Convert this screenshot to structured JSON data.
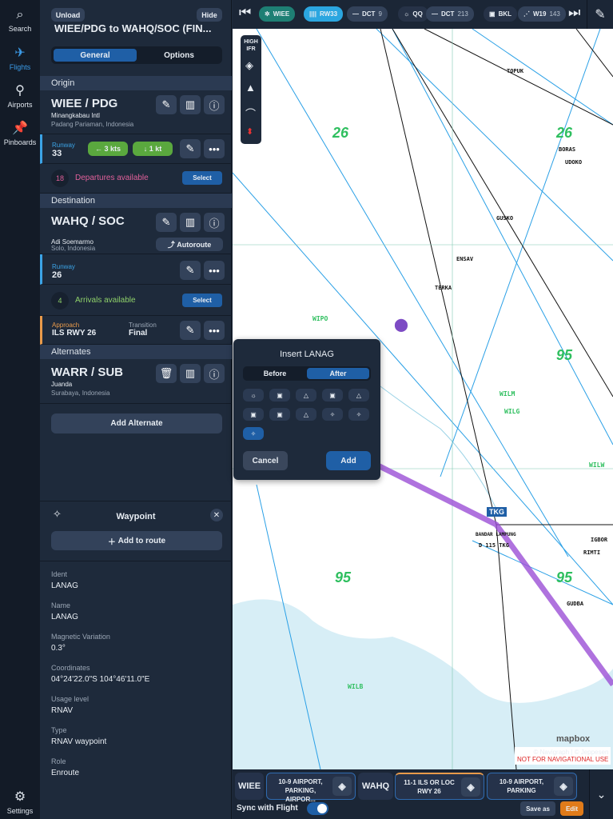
{
  "rail": {
    "items": [
      {
        "label": "Search",
        "icon": "search-icon"
      },
      {
        "label": "Flights",
        "icon": "plane-icon"
      },
      {
        "label": "Airports",
        "icon": "airport-icon"
      },
      {
        "label": "Pinboards",
        "icon": "pin-icon"
      }
    ],
    "settings": "Settings"
  },
  "flight": {
    "unload": "Unload",
    "hide": "Hide",
    "title": "WIEE/PDG to WAHQ/SOC (FIN...",
    "tabs": [
      "General",
      "Options"
    ],
    "origin": {
      "header": "Origin",
      "code": "WIEE / PDG",
      "name": "Minangkabau Intl",
      "city": "Padang Pariaman, Indonesia",
      "runway_label": "Runway",
      "runway": "33",
      "wind1": "← 3 kts",
      "wind2": "↓ 1 kt",
      "departures_count": "18",
      "departures_text": "Departures available",
      "select": "Select"
    },
    "destination": {
      "header": "Destination",
      "code": "WAHQ / SOC",
      "name": "Adi Soemarmo",
      "city": "Solo, Indonesia",
      "autoroute": "Autoroute",
      "runway_label": "Runway",
      "runway": "26",
      "arrivals_count": "4",
      "arrivals_text": "Arrivals available",
      "select": "Select",
      "approach_label": "Approach",
      "approach": "ILS RWY 26",
      "transition_label": "Transition",
      "transition": "Final"
    },
    "alternates": {
      "header": "Alternates",
      "code": "WARR / SUB",
      "name": "Juanda",
      "city": "Surabaya, Indonesia",
      "add": "Add Alternate"
    }
  },
  "waypoint": {
    "title": "Waypoint",
    "add": "Add to route",
    "fields": [
      {
        "label": "Ident",
        "value": "LANAG"
      },
      {
        "label": "Name",
        "value": "LANAG"
      },
      {
        "label": "Magnetic Variation",
        "value": "0.3°"
      },
      {
        "label": "Coordinates",
        "value": "04°24'22.0\"S  104°46'11.0\"E"
      },
      {
        "label": "Usage level",
        "value": "RNAV"
      },
      {
        "label": "Type",
        "value": "RNAV waypoint"
      },
      {
        "label": "Role",
        "value": "Enroute"
      }
    ]
  },
  "topbar": {
    "chips": [
      {
        "label": "WIEE",
        "extra": "",
        "icon": "airport-icon",
        "color": "#1e7f74"
      },
      {
        "label": "RW33",
        "extra": "",
        "icon": "runway-icon",
        "color": "#2ba6e0"
      },
      {
        "label": "DCT",
        "extra": "9",
        "icon": "direct-icon",
        "color": "#33425a"
      },
      {
        "label": "QQ",
        "extra": "",
        "icon": "vor-icon",
        "color": "#263247"
      },
      {
        "label": "DCT",
        "extra": "213",
        "icon": "direct-icon",
        "color": "#33425a"
      },
      {
        "label": "BKL",
        "extra": "",
        "icon": "ndb-icon",
        "color": "#263247"
      },
      {
        "label": "W19",
        "extra": "143",
        "icon": "airway-icon",
        "color": "#33425a"
      }
    ]
  },
  "map": {
    "layer_label": "HIGH IFR",
    "waypoints": [
      "TOPUK",
      "BORAS",
      "UDOKO",
      "GUSKO",
      "ENSAV",
      "TERKA",
      "RIMTI",
      "IGBOR",
      "GUDBA",
      "WIPO",
      "WILM",
      "WILG",
      "WILW",
      "WILB",
      "BANDAR LAMPUNG"
    ],
    "navaid": "TKG",
    "navaid_freq": "D 115 TKG",
    "mora": [
      "26",
      "26",
      "95",
      "95",
      "95"
    ],
    "attribution": "© Navigraph | © Jeppesen",
    "warning": "NOT FOR NAVIGATIONAL USE",
    "mapbox": "mapbox"
  },
  "dialog": {
    "title": "Insert LANAG",
    "before": "Before",
    "after": "After",
    "cancel": "Cancel",
    "add": "Add"
  },
  "bottombar": {
    "origin": "WIEE",
    "origin_chart": "10-9 AIRPORT, PARKING, AIRPOR...",
    "dest": "WAHQ",
    "dest_chart1": "11-1 ILS OR LOC RWY 26",
    "dest_chart2": "10-9 AIRPORT, PARKING",
    "sync": "Sync with Flight",
    "sync_on": true,
    "save_as": "Save as",
    "edit": "Edit"
  }
}
